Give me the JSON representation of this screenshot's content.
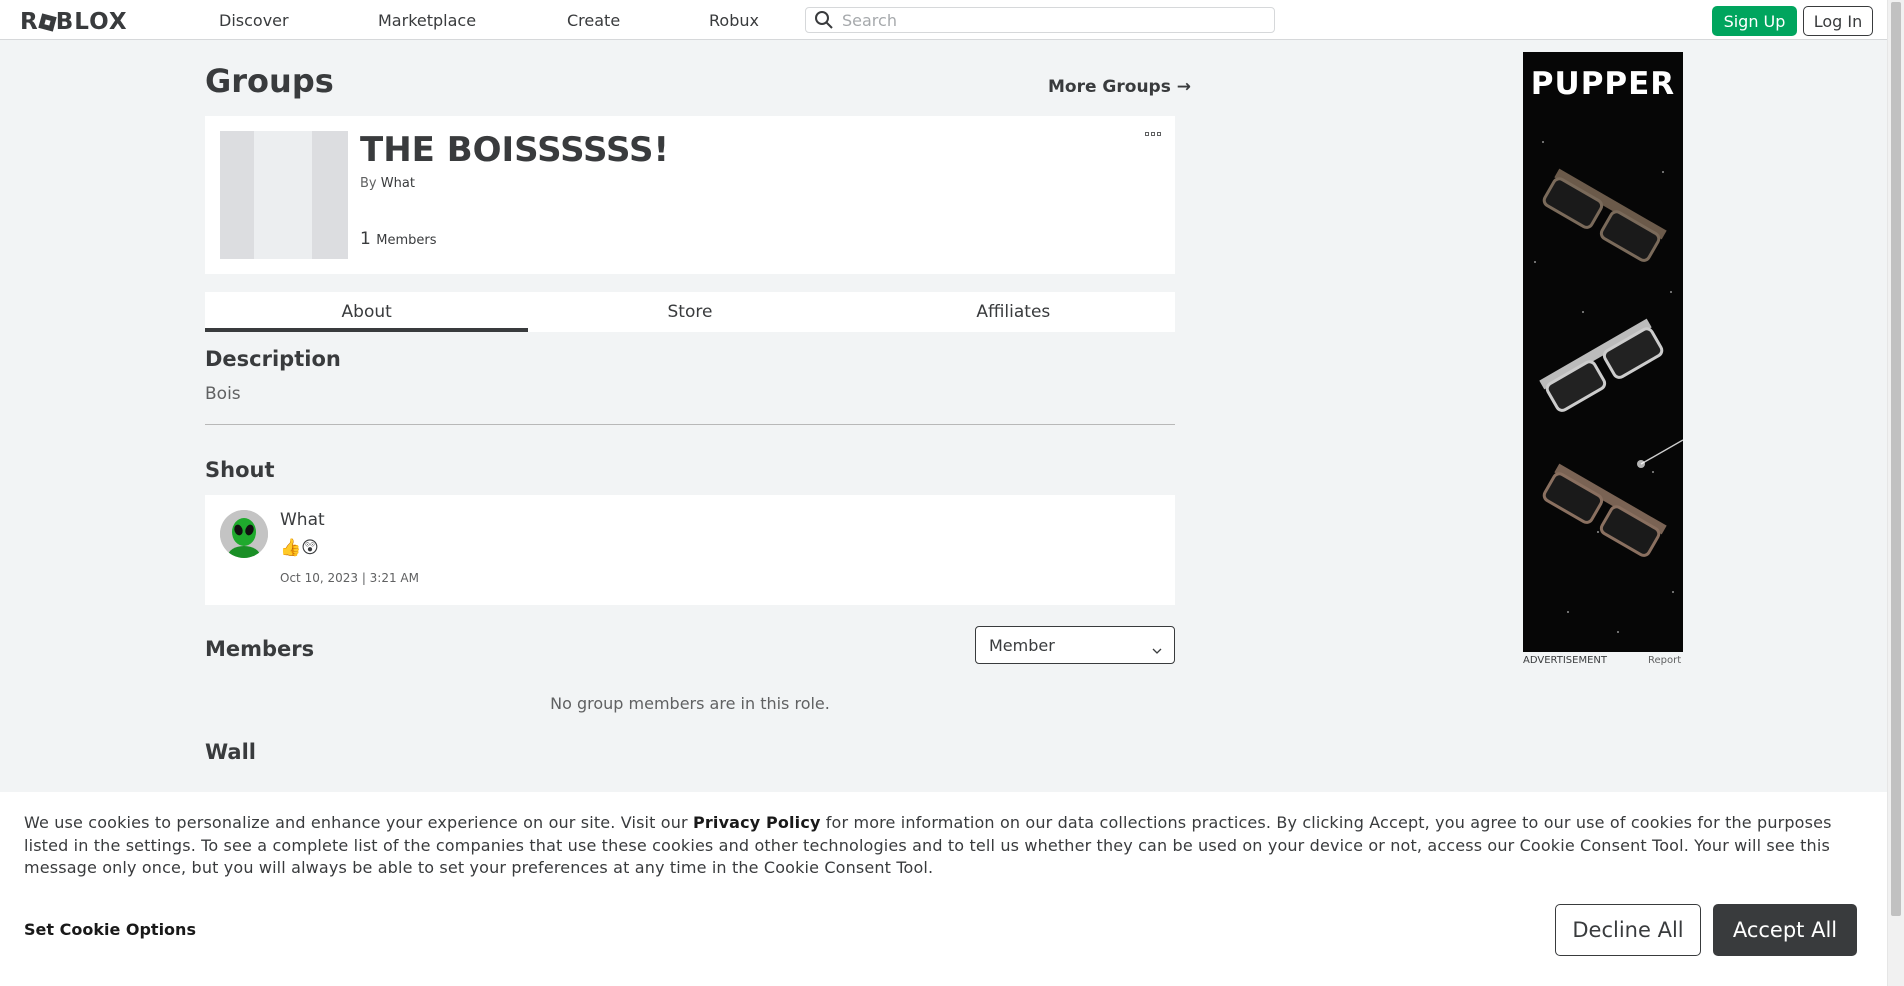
{
  "nav": {
    "logo": "ROBLOX",
    "links": [
      "Discover",
      "Marketplace",
      "Create",
      "Robux"
    ],
    "search_placeholder": "Search",
    "signup_label": "Sign Up",
    "login_label": "Log In"
  },
  "page": {
    "heading": "Groups",
    "more_groups": "More Groups →"
  },
  "group": {
    "name": "THE BOISSSSSS!",
    "by_label": "By",
    "owner": "What",
    "member_count": "1",
    "members_label": "Members"
  },
  "tabs": [
    {
      "label": "About",
      "active": true
    },
    {
      "label": "Store",
      "active": false
    },
    {
      "label": "Affiliates",
      "active": false
    }
  ],
  "about": {
    "description_title": "Description",
    "description": "Bois",
    "shout_title": "Shout",
    "shout": {
      "author": "What",
      "body": "👍😲",
      "date": "Oct 10, 2023 | 3:21 AM"
    },
    "members_title": "Members",
    "role_selected": "Member",
    "no_members": "No group members are in this role.",
    "wall_title": "Wall"
  },
  "ad": {
    "title": "PUPPER",
    "label": "ADVERTISEMENT",
    "report": "Report"
  },
  "cookie": {
    "text_1": "We use cookies to personalize and enhance your experience on our site. Visit our ",
    "privacy_link": "Privacy Policy",
    "text_2": " for more information on our data collections practices. By clicking Accept, you agree to our use of cookies for the purposes listed in the settings. To see a complete list of the companies that use these cookies and other technologies and to tell us whether they can be used on your device or not, access our Cookie Consent Tool. Your will see this message only once, but you will always be able to set your preferences at any time in the Cookie Consent Tool.",
    "set_options": "Set Cookie Options",
    "decline": "Decline All",
    "accept": "Accept All"
  },
  "colors": {
    "accent_green": "#00a55e",
    "text_dark": "#393b3d",
    "page_bg": "#f2f4f5"
  }
}
